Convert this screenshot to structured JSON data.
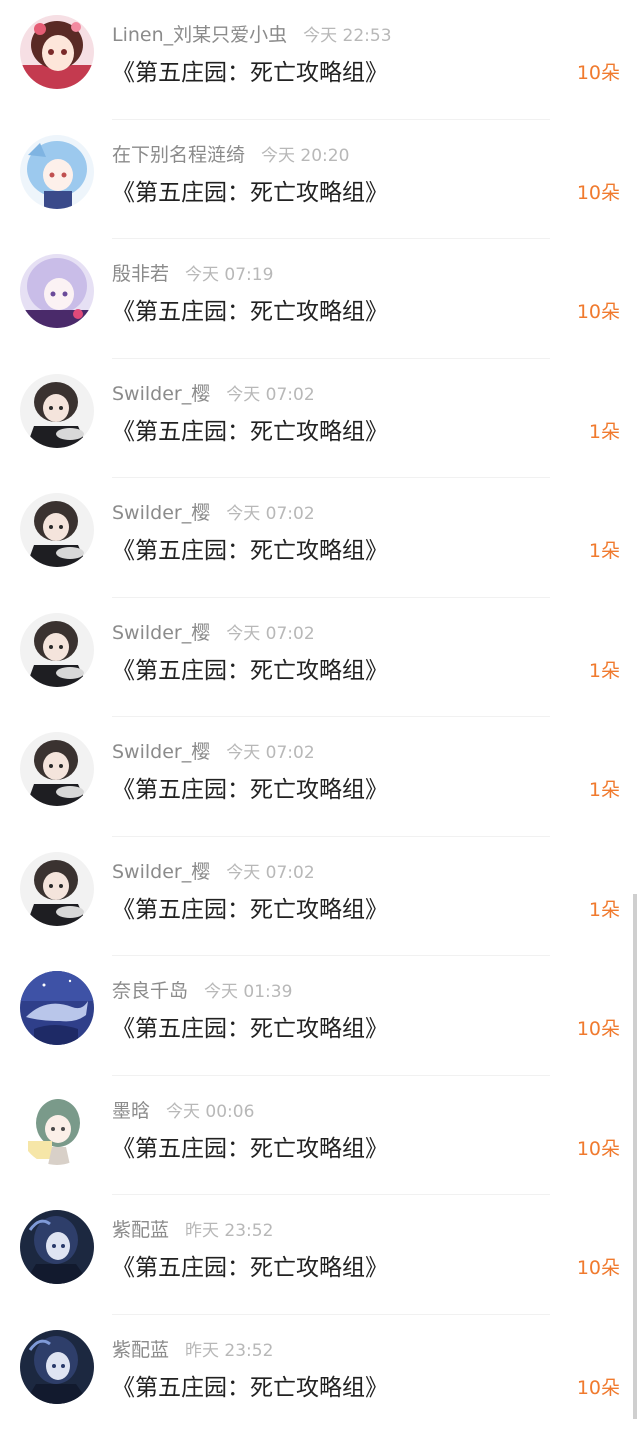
{
  "colors": {
    "name": "#8b8b8b",
    "time": "#b8b8b8",
    "title": "#222222",
    "count_accent": "#f07a2e",
    "divider": "#f1f1f1"
  },
  "items": [
    {
      "name": "Linen_刘某只爱小虫",
      "time": "今天 22:53",
      "title": "《第五庄园：死亡攻略组》",
      "count": "10朵",
      "avatar_icon": "pink-hair-girl-avatar"
    },
    {
      "name": "在下别名程涟绮",
      "time": "今天 20:20",
      "title": "《第五庄园：死亡攻略组》",
      "count": "10朵",
      "avatar_icon": "blue-hair-girl-avatar"
    },
    {
      "name": "殷非若",
      "time": "今天 07:19",
      "title": "《第五庄园：死亡攻略组》",
      "count": "10朵",
      "avatar_icon": "lavender-hair-girl-avatar"
    },
    {
      "name": "Swilder_樱",
      "time": "今天 07:02",
      "title": "《第五庄园：死亡攻略组》",
      "count": "1朵",
      "avatar_icon": "dark-hair-boy-avatar"
    },
    {
      "name": "Swilder_樱",
      "time": "今天 07:02",
      "title": "《第五庄园：死亡攻略组》",
      "count": "1朵",
      "avatar_icon": "dark-hair-boy-avatar"
    },
    {
      "name": "Swilder_樱",
      "time": "今天 07:02",
      "title": "《第五庄园：死亡攻略组》",
      "count": "1朵",
      "avatar_icon": "dark-hair-boy-avatar"
    },
    {
      "name": "Swilder_樱",
      "time": "今天 07:02",
      "title": "《第五庄园：死亡攻略组》",
      "count": "1朵",
      "avatar_icon": "dark-hair-boy-avatar"
    },
    {
      "name": "Swilder_樱",
      "time": "今天 07:02",
      "title": "《第五庄园：死亡攻略组》",
      "count": "1朵",
      "avatar_icon": "dark-hair-boy-avatar"
    },
    {
      "name": "奈良千岛",
      "time": "今天 01:39",
      "title": "《第五庄园：死亡攻略组》",
      "count": "10朵",
      "avatar_icon": "blue-whale-avatar"
    },
    {
      "name": "墨晗",
      "time": "今天 00:06",
      "title": "《第五庄园：死亡攻略组》",
      "count": "10朵",
      "avatar_icon": "green-hair-girl-avatar"
    },
    {
      "name": "紫配蓝",
      "time": "昨天 23:52",
      "title": "《第五庄园：死亡攻略组》",
      "count": "10朵",
      "avatar_icon": "blue-dark-character-avatar"
    },
    {
      "name": "紫配蓝",
      "time": "昨天 23:52",
      "title": "《第五庄园：死亡攻略组》",
      "count": "10朵",
      "avatar_icon": "blue-dark-character-avatar"
    }
  ]
}
